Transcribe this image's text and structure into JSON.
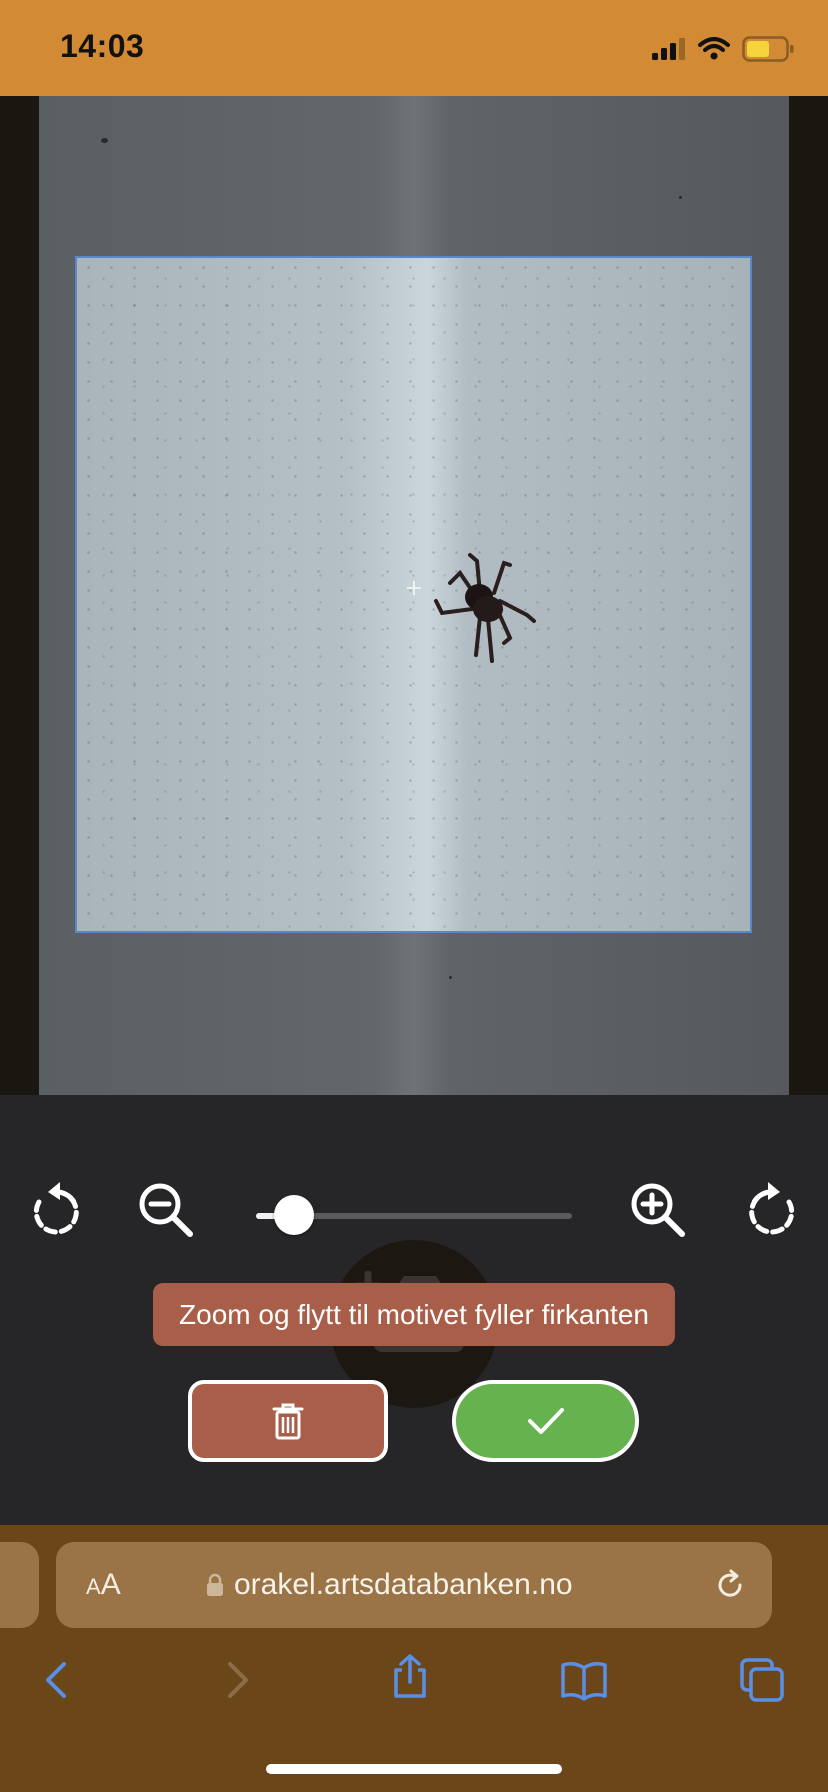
{
  "status_bar": {
    "time": "14:03",
    "icons": [
      "cellular-signal-icon",
      "wifi-icon",
      "battery-icon"
    ],
    "background": "#d28a34"
  },
  "photo": {
    "subject": "spider-icon"
  },
  "editor": {
    "zoom_level": 0.12,
    "hint_text": "Zoom og flytt til motivet fyller firkanten",
    "icons": [
      "rotate-left-icon",
      "zoom-out-icon",
      "zoom-in-icon",
      "rotate-right-icon",
      "trash-icon",
      "checkmark-icon",
      "camera-icon"
    ],
    "delete_color": "#a85e48",
    "confirm_color": "#66b24e",
    "crop_border_color": "#5b87c9"
  },
  "browser": {
    "text_size_label_large": "A",
    "text_size_label_small": "A",
    "url": "orakel.artsdatabanken.no",
    "icons": [
      "lock-icon",
      "reload-icon",
      "back-icon",
      "forward-icon",
      "share-icon",
      "bookmarks-icon",
      "tabs-icon"
    ],
    "background": "#6b4618",
    "accent": "#5a8fe6"
  }
}
